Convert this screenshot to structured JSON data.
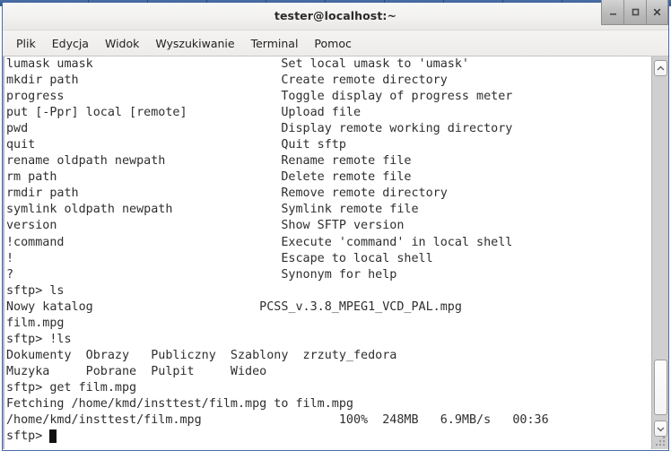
{
  "window": {
    "title": "tester@localhost:~",
    "controls": [
      {
        "name": "minimize-button",
        "glyph": "_"
      },
      {
        "name": "maximize-button",
        "glyph": "□"
      },
      {
        "name": "close-button",
        "glyph": "×"
      }
    ]
  },
  "menubar": {
    "items": [
      {
        "label": "Plik"
      },
      {
        "label": "Edycja"
      },
      {
        "label": "Widok"
      },
      {
        "label": "Wyszukiwanie"
      },
      {
        "label": "Terminal"
      },
      {
        "label": "Pomoc"
      }
    ]
  },
  "terminal": {
    "prompt": "sftp>",
    "cursor_visible": true,
    "help_table": [
      {
        "command": "lumask umask",
        "description": "Set local umask to 'umask'"
      },
      {
        "command": "mkdir path",
        "description": "Create remote directory"
      },
      {
        "command": "progress",
        "description": "Toggle display of progress meter"
      },
      {
        "command": "put [-Ppr] local [remote]",
        "description": "Upload file"
      },
      {
        "command": "pwd",
        "description": "Display remote working directory"
      },
      {
        "command": "quit",
        "description": "Quit sftp"
      },
      {
        "command": "rename oldpath newpath",
        "description": "Rename remote file"
      },
      {
        "command": "rm path",
        "description": "Delete remote file"
      },
      {
        "command": "rmdir path",
        "description": "Remove remote directory"
      },
      {
        "command": "symlink oldpath newpath",
        "description": "Symlink remote file"
      },
      {
        "command": "version",
        "description": "Show SFTP version"
      },
      {
        "command": "!command",
        "description": "Execute 'command' in local shell"
      },
      {
        "command": "!",
        "description": "Escape to local shell"
      },
      {
        "command": "?",
        "description": "Synonym for help"
      }
    ],
    "session": [
      {
        "type": "prompt",
        "command": "ls"
      },
      {
        "type": "output",
        "text": "Nowy katalog                       PCSS_v.3.8_MPEG1_VCD_PAL.mpg"
      },
      {
        "type": "output",
        "text": "film.mpg"
      },
      {
        "type": "prompt",
        "command": "!ls"
      },
      {
        "type": "output",
        "text": "Dokumenty  Obrazy   Publiczny  Szablony  zrzuty_fedora"
      },
      {
        "type": "output",
        "text": "Muzyka     Pobrane  Pulpit     Wideo"
      },
      {
        "type": "prompt",
        "command": "get film.mpg"
      },
      {
        "type": "output",
        "text": "Fetching /home/kmd/insttest/film.mpg to film.mpg"
      },
      {
        "type": "transfer",
        "text": "/home/kmd/insttest/film.mpg                   100%  248MB   6.9MB/s   00:36"
      }
    ],
    "transfer_status": {
      "path": "/home/kmd/insttest/film.mpg",
      "percent": "100%",
      "size": "248MB",
      "rate": "6.9MB/s",
      "eta": "00:36"
    },
    "remote_listing": [
      "Nowy katalog",
      "PCSS_v.3.8_MPEG1_VCD_PAL.mpg",
      "film.mpg"
    ],
    "local_listing": [
      "Dokumenty",
      "Obrazy",
      "Publiczny",
      "Szablony",
      "zrzuty_fedora",
      "Muzyka",
      "Pobrane",
      "Pulpit",
      "Wideo"
    ],
    "screen_text": "lumask umask                          Set local umask to 'umask'\nmkdir path                            Create remote directory\nprogress                              Toggle display of progress meter\nput [-Ppr] local [remote]             Upload file\npwd                                   Display remote working directory\nquit                                  Quit sftp\nrename oldpath newpath                Rename remote file\nrm path                               Delete remote file\nrmdir path                            Remove remote directory\nsymlink oldpath newpath               Symlink remote file\nversion                               Show SFTP version\n!command                              Execute 'command' in local shell\n!                                     Escape to local shell\n?                                     Synonym for help\nsftp> ls\nNowy katalog                       PCSS_v.3.8_MPEG1_VCD_PAL.mpg\nfilm.mpg\nsftp> !ls\nDokumenty  Obrazy   Publiczny  Szablony  zrzuty_fedora\nMuzyka     Pobrane  Pulpit     Wideo\nsftp> get film.mpg\nFetching /home/kmd/insttest/film.mpg to film.mpg\n/home/kmd/insttest/film.mpg                   100%  248MB   6.9MB/s   00:36\nsftp> "
  },
  "scrollbar": {
    "up_arrow": "˄",
    "down_arrow": "˅"
  },
  "colors": {
    "panel_blue": "#3d639b",
    "window_border": "#4b6ca5",
    "terminal_bg": "#ffffff",
    "terminal_fg": "#2e2e2e",
    "titlebar_bg": "#f2f1f0"
  }
}
